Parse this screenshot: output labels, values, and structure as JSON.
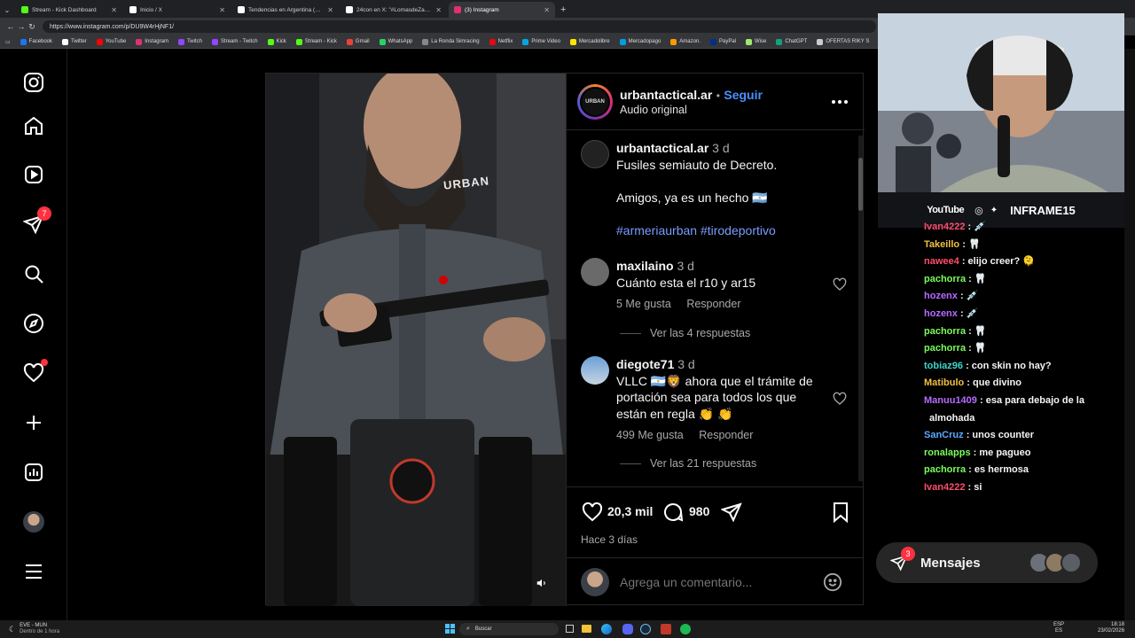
{
  "browser": {
    "tabs": [
      {
        "title": "Stream - Kick Dashboard",
        "color": "#53fc18"
      },
      {
        "title": "Inicio / X",
        "color": "#ffffff"
      },
      {
        "title": "Tendencias en Argentina (@porqu",
        "color": "#ffffff"
      },
      {
        "title": "24con en X: \"#LomasdeZamora lh",
        "color": "#ffffff"
      },
      {
        "title": "(3) Instagram",
        "color": "#e1306c"
      }
    ],
    "active_tab": 4,
    "url": "https://www.instagram.com/p/DU9W4rHjNF1/",
    "bookmarks": [
      {
        "label": "Facebook",
        "color": "#1877f2"
      },
      {
        "label": "Twitter",
        "color": "#ffffff"
      },
      {
        "label": "YouTube",
        "color": "#ff0000"
      },
      {
        "label": "Instagram",
        "color": "#e1306c"
      },
      {
        "label": "Twitch",
        "color": "#9146ff"
      },
      {
        "label": "Stream - Twitch",
        "color": "#9146ff"
      },
      {
        "label": "Kick",
        "color": "#53fc18"
      },
      {
        "label": "Stream - Kick",
        "color": "#53fc18"
      },
      {
        "label": "Gmail",
        "color": "#ea4335"
      },
      {
        "label": "WhatsApp",
        "color": "#25d366"
      },
      {
        "label": "La Ronda Simracing",
        "color": "#888888"
      },
      {
        "label": "Netflix",
        "color": "#e50914"
      },
      {
        "label": "Prime Video",
        "color": "#00a8e1"
      },
      {
        "label": "Mercadolibre",
        "color": "#ffe600"
      },
      {
        "label": "Mercadopago",
        "color": "#009ee3"
      },
      {
        "label": "Amazon.",
        "color": "#ff9900"
      },
      {
        "label": "PayPal",
        "color": "#003087"
      },
      {
        "label": "Wise",
        "color": "#9fe870"
      },
      {
        "label": "ChatGPT",
        "color": "#10a37f"
      },
      {
        "label": "OFERTAS RIKY S",
        "color": "#cccccc"
      }
    ]
  },
  "nav": {
    "notifications_badge": "7"
  },
  "post": {
    "username": "urbantactical.ar",
    "follow_label": "Seguir",
    "separator": "•",
    "audio": "Audio original",
    "avatar_text": "URBAN",
    "caption": {
      "user": "urbantactical.ar",
      "time": "3 d",
      "line1": "Fusiles semiauto de Decreto.",
      "line2": "Amigos, ya es un hecho 🇦🇷",
      "hashtags": "#armeriaurban #tirodeportivo"
    },
    "comments": [
      {
        "user": "maxilaino",
        "time": "3 d",
        "text": "Cuánto esta el r10 y ar15",
        "likes": "5 Me gusta",
        "reply": "Responder",
        "replies": "Ver las 4 respuestas"
      },
      {
        "user": "diegote71",
        "time": "3 d",
        "text_l1": "VLLC 🇦🇷🦁 ahora que el trámite de",
        "text_l2": "portación sea para todos los que",
        "text_l3": "están en regla 👏 👏",
        "likes": "499 Me gusta",
        "reply": "Responder",
        "replies": "Ver las 21 respuestas"
      }
    ],
    "like_count": "20,3 mil",
    "comment_count": "980",
    "posted": "Hace 3 días",
    "add_comment_placeholder": "Agrega un comentario...",
    "video_text": "URBAN"
  },
  "stream": {
    "social_youtube": "YouTube",
    "handle": "INFRAME15",
    "chat": [
      {
        "user": "Ivan4222",
        "color": "#ff4d6d",
        "text": ": 💉"
      },
      {
        "user": "Takeillo",
        "color": "#f0c040",
        "text": ": 🦷"
      },
      {
        "user": "nawee4",
        "color": "#ff4d6d",
        "text": ": elijo creer? 🫠"
      },
      {
        "user": "pachorra",
        "color": "#7cfc5a",
        "text": ": 🦷"
      },
      {
        "user": "hozenx",
        "color": "#b66bff",
        "text": ": 💉"
      },
      {
        "user": "hozenx",
        "color": "#b66bff",
        "text": ": 💉"
      },
      {
        "user": "pachorra",
        "color": "#7cfc5a",
        "text": ": 🦷"
      },
      {
        "user": "pachorra",
        "color": "#7cfc5a",
        "text": ": 🦷"
      },
      {
        "user": "tobiaz96",
        "color": "#3cd6c8",
        "text": ": con skin no hay?"
      },
      {
        "user": "Matibulo",
        "color": "#f0c040",
        "text": ": que divino"
      },
      {
        "user": "Manuu1409",
        "color": "#b66bff",
        "text": ": esa para debajo de la"
      },
      {
        "user": "",
        "color": "#ffffff",
        "text": "almohada"
      },
      {
        "user": "SanCruz",
        "color": "#5aa9ff",
        "text": ": unos counter"
      },
      {
        "user": "ronalapps",
        "color": "#7cfc5a",
        "text": ": me pagueo"
      },
      {
        "user": "pachorra",
        "color": "#7cfc5a",
        "text": ": es hermosa"
      },
      {
        "user": "Ivan4222",
        "color": "#ff4d6d",
        "text": ": si"
      }
    ]
  },
  "messages": {
    "label": "Mensajes",
    "badge": "3"
  },
  "taskbar": {
    "weather_l1": "EVE - MUN",
    "weather_l2": "Dentro de 1 hora",
    "search": "Buscar",
    "lang_l1": "ESP",
    "lang_l2": "ES",
    "time": "18:18",
    "date": "23/02/2026"
  }
}
